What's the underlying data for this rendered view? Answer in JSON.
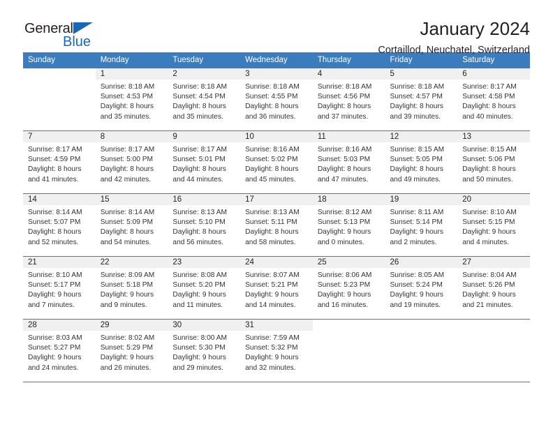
{
  "logo": {
    "word_top": "General",
    "word_bottom": "Blue",
    "triangle_icon": "triangle-icon",
    "brand_color": "#1569b6"
  },
  "header": {
    "title": "January 2024",
    "location": "Cortaillod, Neuchatel, Switzerland"
  },
  "theme": {
    "header_bg": "#3a7cbe",
    "daynum_bg": "#f0f0f0",
    "rule_color": "#3a7cbe"
  },
  "weekdays": [
    "Sunday",
    "Monday",
    "Tuesday",
    "Wednesday",
    "Thursday",
    "Friday",
    "Saturday"
  ],
  "weeks": [
    [
      {
        "day": "",
        "sunrise": "",
        "sunset": "",
        "daylight1": "",
        "daylight2": ""
      },
      {
        "day": "1",
        "sunrise": "Sunrise: 8:18 AM",
        "sunset": "Sunset: 4:53 PM",
        "daylight1": "Daylight: 8 hours",
        "daylight2": "and 35 minutes."
      },
      {
        "day": "2",
        "sunrise": "Sunrise: 8:18 AM",
        "sunset": "Sunset: 4:54 PM",
        "daylight1": "Daylight: 8 hours",
        "daylight2": "and 35 minutes."
      },
      {
        "day": "3",
        "sunrise": "Sunrise: 8:18 AM",
        "sunset": "Sunset: 4:55 PM",
        "daylight1": "Daylight: 8 hours",
        "daylight2": "and 36 minutes."
      },
      {
        "day": "4",
        "sunrise": "Sunrise: 8:18 AM",
        "sunset": "Sunset: 4:56 PM",
        "daylight1": "Daylight: 8 hours",
        "daylight2": "and 37 minutes."
      },
      {
        "day": "5",
        "sunrise": "Sunrise: 8:18 AM",
        "sunset": "Sunset: 4:57 PM",
        "daylight1": "Daylight: 8 hours",
        "daylight2": "and 39 minutes."
      },
      {
        "day": "6",
        "sunrise": "Sunrise: 8:17 AM",
        "sunset": "Sunset: 4:58 PM",
        "daylight1": "Daylight: 8 hours",
        "daylight2": "and 40 minutes."
      }
    ],
    [
      {
        "day": "7",
        "sunrise": "Sunrise: 8:17 AM",
        "sunset": "Sunset: 4:59 PM",
        "daylight1": "Daylight: 8 hours",
        "daylight2": "and 41 minutes."
      },
      {
        "day": "8",
        "sunrise": "Sunrise: 8:17 AM",
        "sunset": "Sunset: 5:00 PM",
        "daylight1": "Daylight: 8 hours",
        "daylight2": "and 42 minutes."
      },
      {
        "day": "9",
        "sunrise": "Sunrise: 8:17 AM",
        "sunset": "Sunset: 5:01 PM",
        "daylight1": "Daylight: 8 hours",
        "daylight2": "and 44 minutes."
      },
      {
        "day": "10",
        "sunrise": "Sunrise: 8:16 AM",
        "sunset": "Sunset: 5:02 PM",
        "daylight1": "Daylight: 8 hours",
        "daylight2": "and 45 minutes."
      },
      {
        "day": "11",
        "sunrise": "Sunrise: 8:16 AM",
        "sunset": "Sunset: 5:03 PM",
        "daylight1": "Daylight: 8 hours",
        "daylight2": "and 47 minutes."
      },
      {
        "day": "12",
        "sunrise": "Sunrise: 8:15 AM",
        "sunset": "Sunset: 5:05 PM",
        "daylight1": "Daylight: 8 hours",
        "daylight2": "and 49 minutes."
      },
      {
        "day": "13",
        "sunrise": "Sunrise: 8:15 AM",
        "sunset": "Sunset: 5:06 PM",
        "daylight1": "Daylight: 8 hours",
        "daylight2": "and 50 minutes."
      }
    ],
    [
      {
        "day": "14",
        "sunrise": "Sunrise: 8:14 AM",
        "sunset": "Sunset: 5:07 PM",
        "daylight1": "Daylight: 8 hours",
        "daylight2": "and 52 minutes."
      },
      {
        "day": "15",
        "sunrise": "Sunrise: 8:14 AM",
        "sunset": "Sunset: 5:09 PM",
        "daylight1": "Daylight: 8 hours",
        "daylight2": "and 54 minutes."
      },
      {
        "day": "16",
        "sunrise": "Sunrise: 8:13 AM",
        "sunset": "Sunset: 5:10 PM",
        "daylight1": "Daylight: 8 hours",
        "daylight2": "and 56 minutes."
      },
      {
        "day": "17",
        "sunrise": "Sunrise: 8:13 AM",
        "sunset": "Sunset: 5:11 PM",
        "daylight1": "Daylight: 8 hours",
        "daylight2": "and 58 minutes."
      },
      {
        "day": "18",
        "sunrise": "Sunrise: 8:12 AM",
        "sunset": "Sunset: 5:13 PM",
        "daylight1": "Daylight: 9 hours",
        "daylight2": "and 0 minutes."
      },
      {
        "day": "19",
        "sunrise": "Sunrise: 8:11 AM",
        "sunset": "Sunset: 5:14 PM",
        "daylight1": "Daylight: 9 hours",
        "daylight2": "and 2 minutes."
      },
      {
        "day": "20",
        "sunrise": "Sunrise: 8:10 AM",
        "sunset": "Sunset: 5:15 PM",
        "daylight1": "Daylight: 9 hours",
        "daylight2": "and 4 minutes."
      }
    ],
    [
      {
        "day": "21",
        "sunrise": "Sunrise: 8:10 AM",
        "sunset": "Sunset: 5:17 PM",
        "daylight1": "Daylight: 9 hours",
        "daylight2": "and 7 minutes."
      },
      {
        "day": "22",
        "sunrise": "Sunrise: 8:09 AM",
        "sunset": "Sunset: 5:18 PM",
        "daylight1": "Daylight: 9 hours",
        "daylight2": "and 9 minutes."
      },
      {
        "day": "23",
        "sunrise": "Sunrise: 8:08 AM",
        "sunset": "Sunset: 5:20 PM",
        "daylight1": "Daylight: 9 hours",
        "daylight2": "and 11 minutes."
      },
      {
        "day": "24",
        "sunrise": "Sunrise: 8:07 AM",
        "sunset": "Sunset: 5:21 PM",
        "daylight1": "Daylight: 9 hours",
        "daylight2": "and 14 minutes."
      },
      {
        "day": "25",
        "sunrise": "Sunrise: 8:06 AM",
        "sunset": "Sunset: 5:23 PM",
        "daylight1": "Daylight: 9 hours",
        "daylight2": "and 16 minutes."
      },
      {
        "day": "26",
        "sunrise": "Sunrise: 8:05 AM",
        "sunset": "Sunset: 5:24 PM",
        "daylight1": "Daylight: 9 hours",
        "daylight2": "and 19 minutes."
      },
      {
        "day": "27",
        "sunrise": "Sunrise: 8:04 AM",
        "sunset": "Sunset: 5:26 PM",
        "daylight1": "Daylight: 9 hours",
        "daylight2": "and 21 minutes."
      }
    ],
    [
      {
        "day": "28",
        "sunrise": "Sunrise: 8:03 AM",
        "sunset": "Sunset: 5:27 PM",
        "daylight1": "Daylight: 9 hours",
        "daylight2": "and 24 minutes."
      },
      {
        "day": "29",
        "sunrise": "Sunrise: 8:02 AM",
        "sunset": "Sunset: 5:29 PM",
        "daylight1": "Daylight: 9 hours",
        "daylight2": "and 26 minutes."
      },
      {
        "day": "30",
        "sunrise": "Sunrise: 8:00 AM",
        "sunset": "Sunset: 5:30 PM",
        "daylight1": "Daylight: 9 hours",
        "daylight2": "and 29 minutes."
      },
      {
        "day": "31",
        "sunrise": "Sunrise: 7:59 AM",
        "sunset": "Sunset: 5:32 PM",
        "daylight1": "Daylight: 9 hours",
        "daylight2": "and 32 minutes."
      },
      {
        "day": "",
        "sunrise": "",
        "sunset": "",
        "daylight1": "",
        "daylight2": ""
      },
      {
        "day": "",
        "sunrise": "",
        "sunset": "",
        "daylight1": "",
        "daylight2": ""
      },
      {
        "day": "",
        "sunrise": "",
        "sunset": "",
        "daylight1": "",
        "daylight2": ""
      }
    ]
  ]
}
